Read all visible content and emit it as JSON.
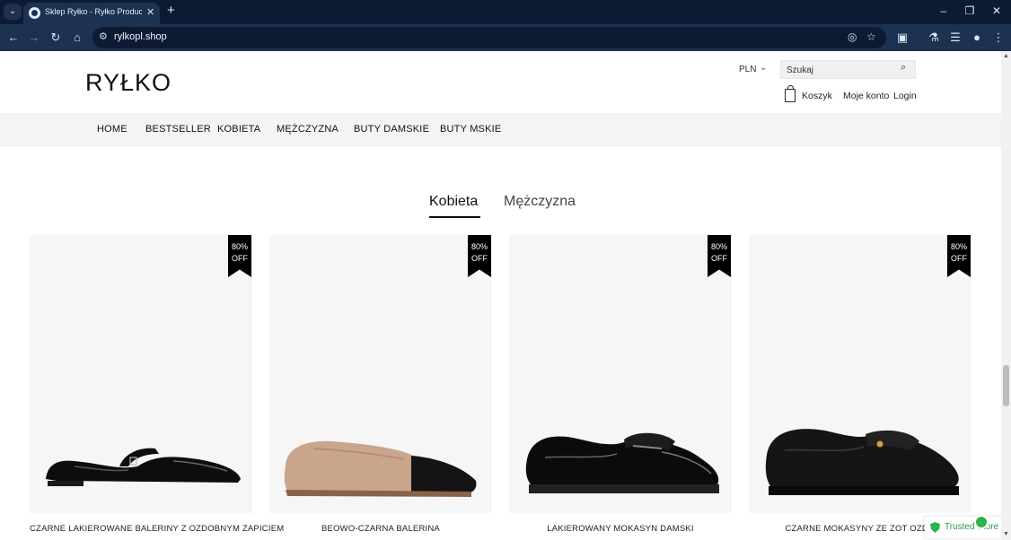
{
  "browser": {
    "tab_title": "Sklep Ryłko - Ryłko Producent",
    "url": "rylkopl.shop"
  },
  "header": {
    "logo": "RYŁKO",
    "currency": "PLN",
    "search_placeholder": "Szukaj",
    "cart_label": "Koszyk",
    "account_label": "Moje konto",
    "login_label": "Login"
  },
  "nav": {
    "items": [
      "HOME",
      "BESTSELLER",
      "KOBIETA",
      "MĘŻCZYZNA",
      "BUTY DAMSKIE",
      "BUTY MSKIE"
    ]
  },
  "category_tabs": {
    "active": "Kobieta",
    "inactive": "Mężczyzna"
  },
  "products": [
    {
      "name": "CZARNE LAKIEROWANE BALERINY Z OZDOBNYM ZAPICIEM",
      "badge_pct": "80%",
      "badge_off": "OFF"
    },
    {
      "name": "BEOWO-CZARNA BALERINA",
      "badge_pct": "80%",
      "badge_off": "OFF"
    },
    {
      "name": "LAKIEROWANY MOKASYN DAMSKI",
      "badge_pct": "80%",
      "badge_off": "OFF"
    },
    {
      "name": "CZARNE MOKASYNY ZE ZOT OZDO",
      "badge_pct": "80%",
      "badge_off": "OFF"
    }
  ],
  "trusted_store": {
    "label": "Trusted Store",
    "color": "#2db34a"
  },
  "icons": {
    "tab_menu": "chevron-down-icon",
    "favicon": "wordpress-icon",
    "close": "close-icon",
    "back": "arrow-left-icon",
    "forward": "arrow-right-icon",
    "reload": "reload-icon",
    "home": "home-icon",
    "site_info": "tune-icon",
    "eye_off": "eye-off-icon",
    "star": "star-icon",
    "extensions": "puzzle-icon",
    "search": "search-icon",
    "cart": "bag-icon"
  }
}
